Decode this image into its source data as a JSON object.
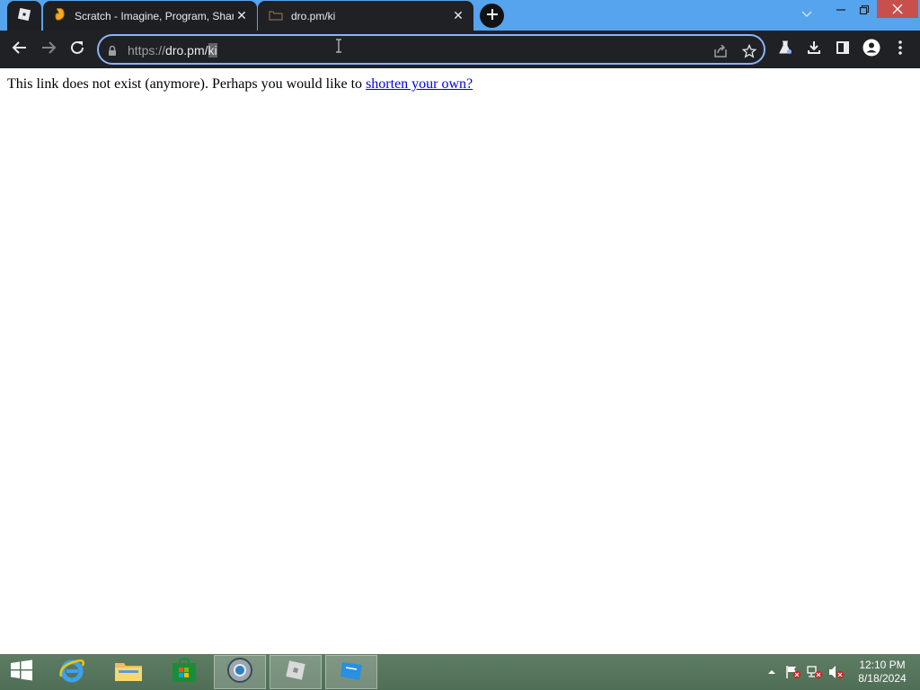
{
  "browser": {
    "pinned_tab_icon": "roblox-icon",
    "tabs": [
      {
        "title": "Scratch - Imagine, Program, Share",
        "icon": "scratch-icon"
      },
      {
        "title": "dro.pm/ki",
        "icon": "site-favicon"
      }
    ],
    "new_tab_icon": "plus-icon",
    "address_bar": {
      "scheme": "https://",
      "host": "dro.pm/",
      "path": "ki"
    }
  },
  "page": {
    "message": "This link does not exist (anymore). Perhaps you would like to ",
    "link_text": "shorten your own?"
  },
  "taskbar": {
    "clock_time": "12:10 PM",
    "clock_date": "8/18/2024"
  },
  "colors": {
    "tabstrip": "#56a3ee",
    "toolbar": "#202124",
    "omnibox_border": "#8ab4f8",
    "link": "#0000ee",
    "taskbar": "#577660"
  }
}
